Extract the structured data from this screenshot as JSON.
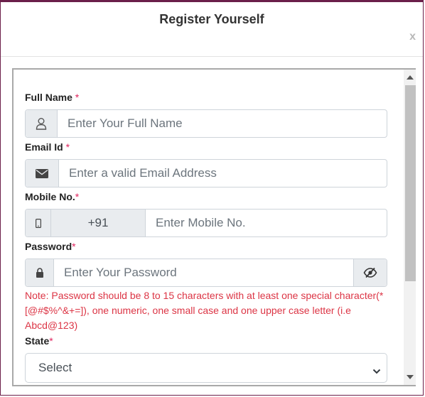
{
  "modal": {
    "title": "Register Yourself",
    "close_label": "x"
  },
  "form": {
    "full_name": {
      "label": "Full Name",
      "required_mark": "*",
      "placeholder": "Enter Your Full Name",
      "icon": "user-icon"
    },
    "email": {
      "label": "Email Id",
      "required_mark": "*",
      "placeholder": "Enter a valid Email Address",
      "icon": "envelope-icon"
    },
    "mobile": {
      "label": "Mobile No.",
      "required_mark": "*",
      "country_code": "+91",
      "placeholder": "Enter Mobile No.",
      "icon": "mobile-phone-icon"
    },
    "password": {
      "label": "Password",
      "required_mark": "*",
      "placeholder": "Enter Your Password",
      "icon": "lock-icon",
      "toggle_icon": "eye-slash-icon",
      "note": "Note: Password should be 8 to 15 characters with at least one special character(*[@#$%^&+=]), one numeric, one small case and one upper case letter (i.e Abcd@123)"
    },
    "state": {
      "label": "State",
      "required_mark": "*",
      "selected": "Select"
    }
  },
  "colors": {
    "accent": "#6b1f4a",
    "required": "#e0245e",
    "note": "#dc3545",
    "addon_bg": "#e9ecef"
  }
}
